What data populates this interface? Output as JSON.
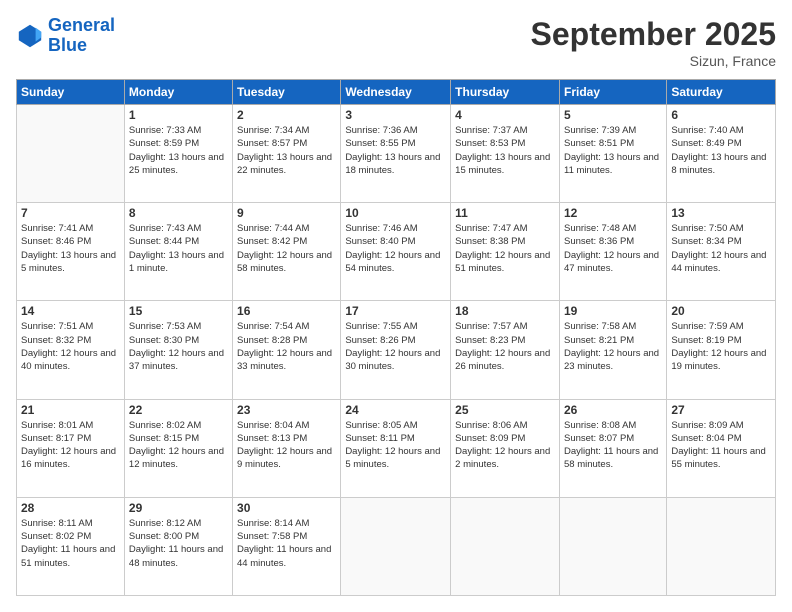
{
  "logo": {
    "line1": "General",
    "line2": "Blue"
  },
  "title": "September 2025",
  "location": "Sizun, France",
  "days_header": [
    "Sunday",
    "Monday",
    "Tuesday",
    "Wednesday",
    "Thursday",
    "Friday",
    "Saturday"
  ],
  "weeks": [
    [
      {
        "day": "",
        "sunrise": "",
        "sunset": "",
        "daylight": ""
      },
      {
        "day": "1",
        "sunrise": "Sunrise: 7:33 AM",
        "sunset": "Sunset: 8:59 PM",
        "daylight": "Daylight: 13 hours and 25 minutes."
      },
      {
        "day": "2",
        "sunrise": "Sunrise: 7:34 AM",
        "sunset": "Sunset: 8:57 PM",
        "daylight": "Daylight: 13 hours and 22 minutes."
      },
      {
        "day": "3",
        "sunrise": "Sunrise: 7:36 AM",
        "sunset": "Sunset: 8:55 PM",
        "daylight": "Daylight: 13 hours and 18 minutes."
      },
      {
        "day": "4",
        "sunrise": "Sunrise: 7:37 AM",
        "sunset": "Sunset: 8:53 PM",
        "daylight": "Daylight: 13 hours and 15 minutes."
      },
      {
        "day": "5",
        "sunrise": "Sunrise: 7:39 AM",
        "sunset": "Sunset: 8:51 PM",
        "daylight": "Daylight: 13 hours and 11 minutes."
      },
      {
        "day": "6",
        "sunrise": "Sunrise: 7:40 AM",
        "sunset": "Sunset: 8:49 PM",
        "daylight": "Daylight: 13 hours and 8 minutes."
      }
    ],
    [
      {
        "day": "7",
        "sunrise": "Sunrise: 7:41 AM",
        "sunset": "Sunset: 8:46 PM",
        "daylight": "Daylight: 13 hours and 5 minutes."
      },
      {
        "day": "8",
        "sunrise": "Sunrise: 7:43 AM",
        "sunset": "Sunset: 8:44 PM",
        "daylight": "Daylight: 13 hours and 1 minute."
      },
      {
        "day": "9",
        "sunrise": "Sunrise: 7:44 AM",
        "sunset": "Sunset: 8:42 PM",
        "daylight": "Daylight: 12 hours and 58 minutes."
      },
      {
        "day": "10",
        "sunrise": "Sunrise: 7:46 AM",
        "sunset": "Sunset: 8:40 PM",
        "daylight": "Daylight: 12 hours and 54 minutes."
      },
      {
        "day": "11",
        "sunrise": "Sunrise: 7:47 AM",
        "sunset": "Sunset: 8:38 PM",
        "daylight": "Daylight: 12 hours and 51 minutes."
      },
      {
        "day": "12",
        "sunrise": "Sunrise: 7:48 AM",
        "sunset": "Sunset: 8:36 PM",
        "daylight": "Daylight: 12 hours and 47 minutes."
      },
      {
        "day": "13",
        "sunrise": "Sunrise: 7:50 AM",
        "sunset": "Sunset: 8:34 PM",
        "daylight": "Daylight: 12 hours and 44 minutes."
      }
    ],
    [
      {
        "day": "14",
        "sunrise": "Sunrise: 7:51 AM",
        "sunset": "Sunset: 8:32 PM",
        "daylight": "Daylight: 12 hours and 40 minutes."
      },
      {
        "day": "15",
        "sunrise": "Sunrise: 7:53 AM",
        "sunset": "Sunset: 8:30 PM",
        "daylight": "Daylight: 12 hours and 37 minutes."
      },
      {
        "day": "16",
        "sunrise": "Sunrise: 7:54 AM",
        "sunset": "Sunset: 8:28 PM",
        "daylight": "Daylight: 12 hours and 33 minutes."
      },
      {
        "day": "17",
        "sunrise": "Sunrise: 7:55 AM",
        "sunset": "Sunset: 8:26 PM",
        "daylight": "Daylight: 12 hours and 30 minutes."
      },
      {
        "day": "18",
        "sunrise": "Sunrise: 7:57 AM",
        "sunset": "Sunset: 8:23 PM",
        "daylight": "Daylight: 12 hours and 26 minutes."
      },
      {
        "day": "19",
        "sunrise": "Sunrise: 7:58 AM",
        "sunset": "Sunset: 8:21 PM",
        "daylight": "Daylight: 12 hours and 23 minutes."
      },
      {
        "day": "20",
        "sunrise": "Sunrise: 7:59 AM",
        "sunset": "Sunset: 8:19 PM",
        "daylight": "Daylight: 12 hours and 19 minutes."
      }
    ],
    [
      {
        "day": "21",
        "sunrise": "Sunrise: 8:01 AM",
        "sunset": "Sunset: 8:17 PM",
        "daylight": "Daylight: 12 hours and 16 minutes."
      },
      {
        "day": "22",
        "sunrise": "Sunrise: 8:02 AM",
        "sunset": "Sunset: 8:15 PM",
        "daylight": "Daylight: 12 hours and 12 minutes."
      },
      {
        "day": "23",
        "sunrise": "Sunrise: 8:04 AM",
        "sunset": "Sunset: 8:13 PM",
        "daylight": "Daylight: 12 hours and 9 minutes."
      },
      {
        "day": "24",
        "sunrise": "Sunrise: 8:05 AM",
        "sunset": "Sunset: 8:11 PM",
        "daylight": "Daylight: 12 hours and 5 minutes."
      },
      {
        "day": "25",
        "sunrise": "Sunrise: 8:06 AM",
        "sunset": "Sunset: 8:09 PM",
        "daylight": "Daylight: 12 hours and 2 minutes."
      },
      {
        "day": "26",
        "sunrise": "Sunrise: 8:08 AM",
        "sunset": "Sunset: 8:07 PM",
        "daylight": "Daylight: 11 hours and 58 minutes."
      },
      {
        "day": "27",
        "sunrise": "Sunrise: 8:09 AM",
        "sunset": "Sunset: 8:04 PM",
        "daylight": "Daylight: 11 hours and 55 minutes."
      }
    ],
    [
      {
        "day": "28",
        "sunrise": "Sunrise: 8:11 AM",
        "sunset": "Sunset: 8:02 PM",
        "daylight": "Daylight: 11 hours and 51 minutes."
      },
      {
        "day": "29",
        "sunrise": "Sunrise: 8:12 AM",
        "sunset": "Sunset: 8:00 PM",
        "daylight": "Daylight: 11 hours and 48 minutes."
      },
      {
        "day": "30",
        "sunrise": "Sunrise: 8:14 AM",
        "sunset": "Sunset: 7:58 PM",
        "daylight": "Daylight: 11 hours and 44 minutes."
      },
      {
        "day": "",
        "sunrise": "",
        "sunset": "",
        "daylight": ""
      },
      {
        "day": "",
        "sunrise": "",
        "sunset": "",
        "daylight": ""
      },
      {
        "day": "",
        "sunrise": "",
        "sunset": "",
        "daylight": ""
      },
      {
        "day": "",
        "sunrise": "",
        "sunset": "",
        "daylight": ""
      }
    ]
  ]
}
